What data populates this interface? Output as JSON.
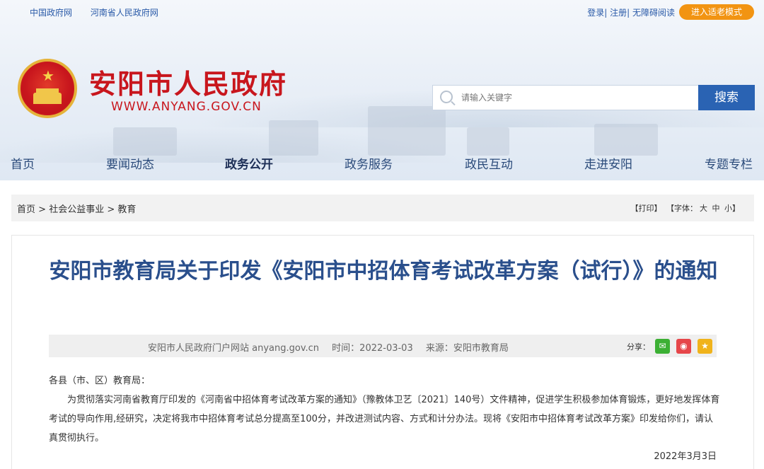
{
  "top_links": [
    "中国政府网",
    "河南省人民政府网"
  ],
  "user_links": {
    "login": "登录",
    "register": "注册",
    "accessible": "无障碍阅读",
    "elder_mode": "进入适老模式"
  },
  "site": {
    "title": "安阳市人民政府",
    "url": "WWW.ANYANG.GOV.CN"
  },
  "search": {
    "placeholder": "请输入关键字",
    "button": "搜索"
  },
  "nav": [
    "首页",
    "要闻动态",
    "政务公开",
    "政务服务",
    "政民互动",
    "走进安阳",
    "专题专栏"
  ],
  "nav_active": "政务公开",
  "breadcrumb": [
    "首页",
    "社会公益事业",
    "教育"
  ],
  "breadcrumb_sep": " > ",
  "tools": {
    "print": "【打印】",
    "font_label": "【字体：",
    "font_large": "大",
    "font_mid": "中",
    "font_small": "小】"
  },
  "article": {
    "title": "安阳市教育局关于印发《安阳市中招体育考试改革方案（试行）》的通知",
    "meta": {
      "site": "安阳市人民政府门户网站 anyang.gov.cn",
      "time": "时间：2022-03-03",
      "source": "来源：安阳市教育局"
    },
    "share_label": "分享：",
    "greeting": "各县（市、区）教育局：",
    "paragraph": "为贯彻落实河南省教育厅印发的《河南省中招体育考试改革方案的通知》（豫教体卫艺〔2021〕140号）文件精神，促进学生积极参加体育锻炼，更好地发挥体育考试的导向作用,经研究，决定将我市中招体育考试总分提高至100分，并改进测试内容、方式和计分办法。现将《安阳市中招体育考试改革方案》印发给你们，请认真贯彻执行。",
    "date": "2022年3月3日"
  },
  "colors": {
    "brand_red": "#c8161d",
    "nav_blue": "#2a4a7a",
    "search_blue": "#2a63b3",
    "elder_orange": "#f29412",
    "title_blue": "#2a4f8c"
  }
}
